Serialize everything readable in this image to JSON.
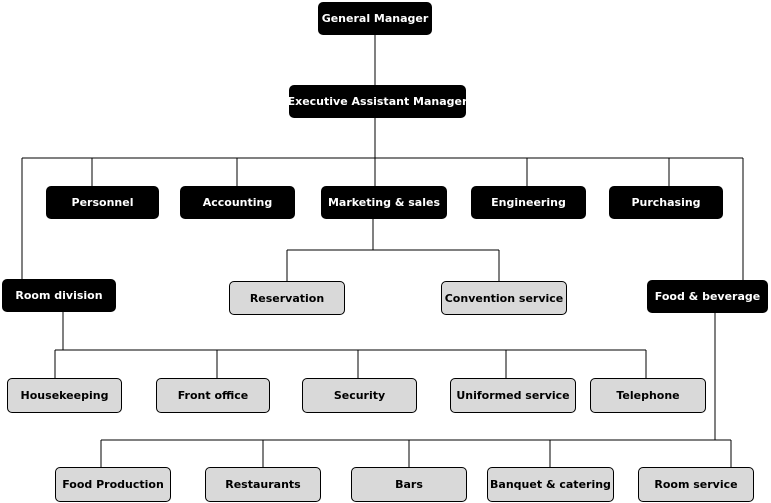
{
  "chart": {
    "top": {
      "general_manager": "General Manager",
      "executive_assistant_manager": "Executive Assistant Manager"
    },
    "departments": [
      "Personnel",
      "Accounting",
      "Marketing & sales",
      "Engineering",
      "Purchasing"
    ],
    "room_division": "Room division",
    "marketing_children": [
      "Reservation",
      "Convention service"
    ],
    "food_beverage": "Food & beverage",
    "room_division_children": [
      "Housekeeping",
      "Front office",
      "Security",
      "Uniformed service",
      "Telephone"
    ],
    "food_beverage_children": [
      "Food Production",
      "Restaurants",
      "Bars",
      "Banquet & catering",
      "Room service"
    ]
  },
  "colors": {
    "dark_box": "#000000",
    "light_box": "#d9d9d9",
    "line": "#000000"
  }
}
